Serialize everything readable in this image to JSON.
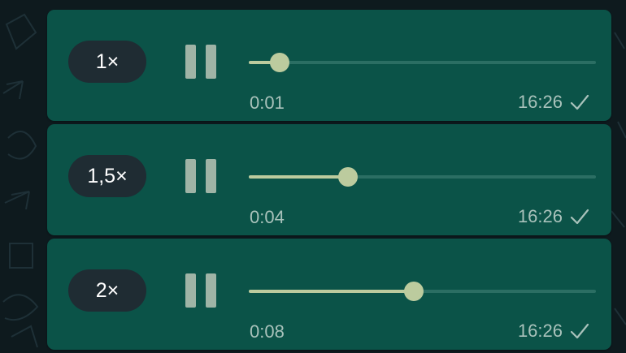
{
  "messages": [
    {
      "speed": "1×",
      "elapsed": "0:01",
      "time": "16:26",
      "progress": 0.09
    },
    {
      "speed": "1,5×",
      "elapsed": "0:04",
      "time": "16:26",
      "progress": 0.285
    },
    {
      "speed": "2×",
      "elapsed": "0:08",
      "time": "16:26",
      "progress": 0.475
    }
  ],
  "colors": {
    "bubble": "#0b5348",
    "speed_pill": "#1f2c33",
    "accent": "#bccb9e",
    "rail": "#2b6e63",
    "meta_text": "#a9c2bb",
    "pause_icon": "#9fb4a6"
  },
  "icons": {
    "pause": "pause-icon",
    "status": "single-check-icon"
  }
}
